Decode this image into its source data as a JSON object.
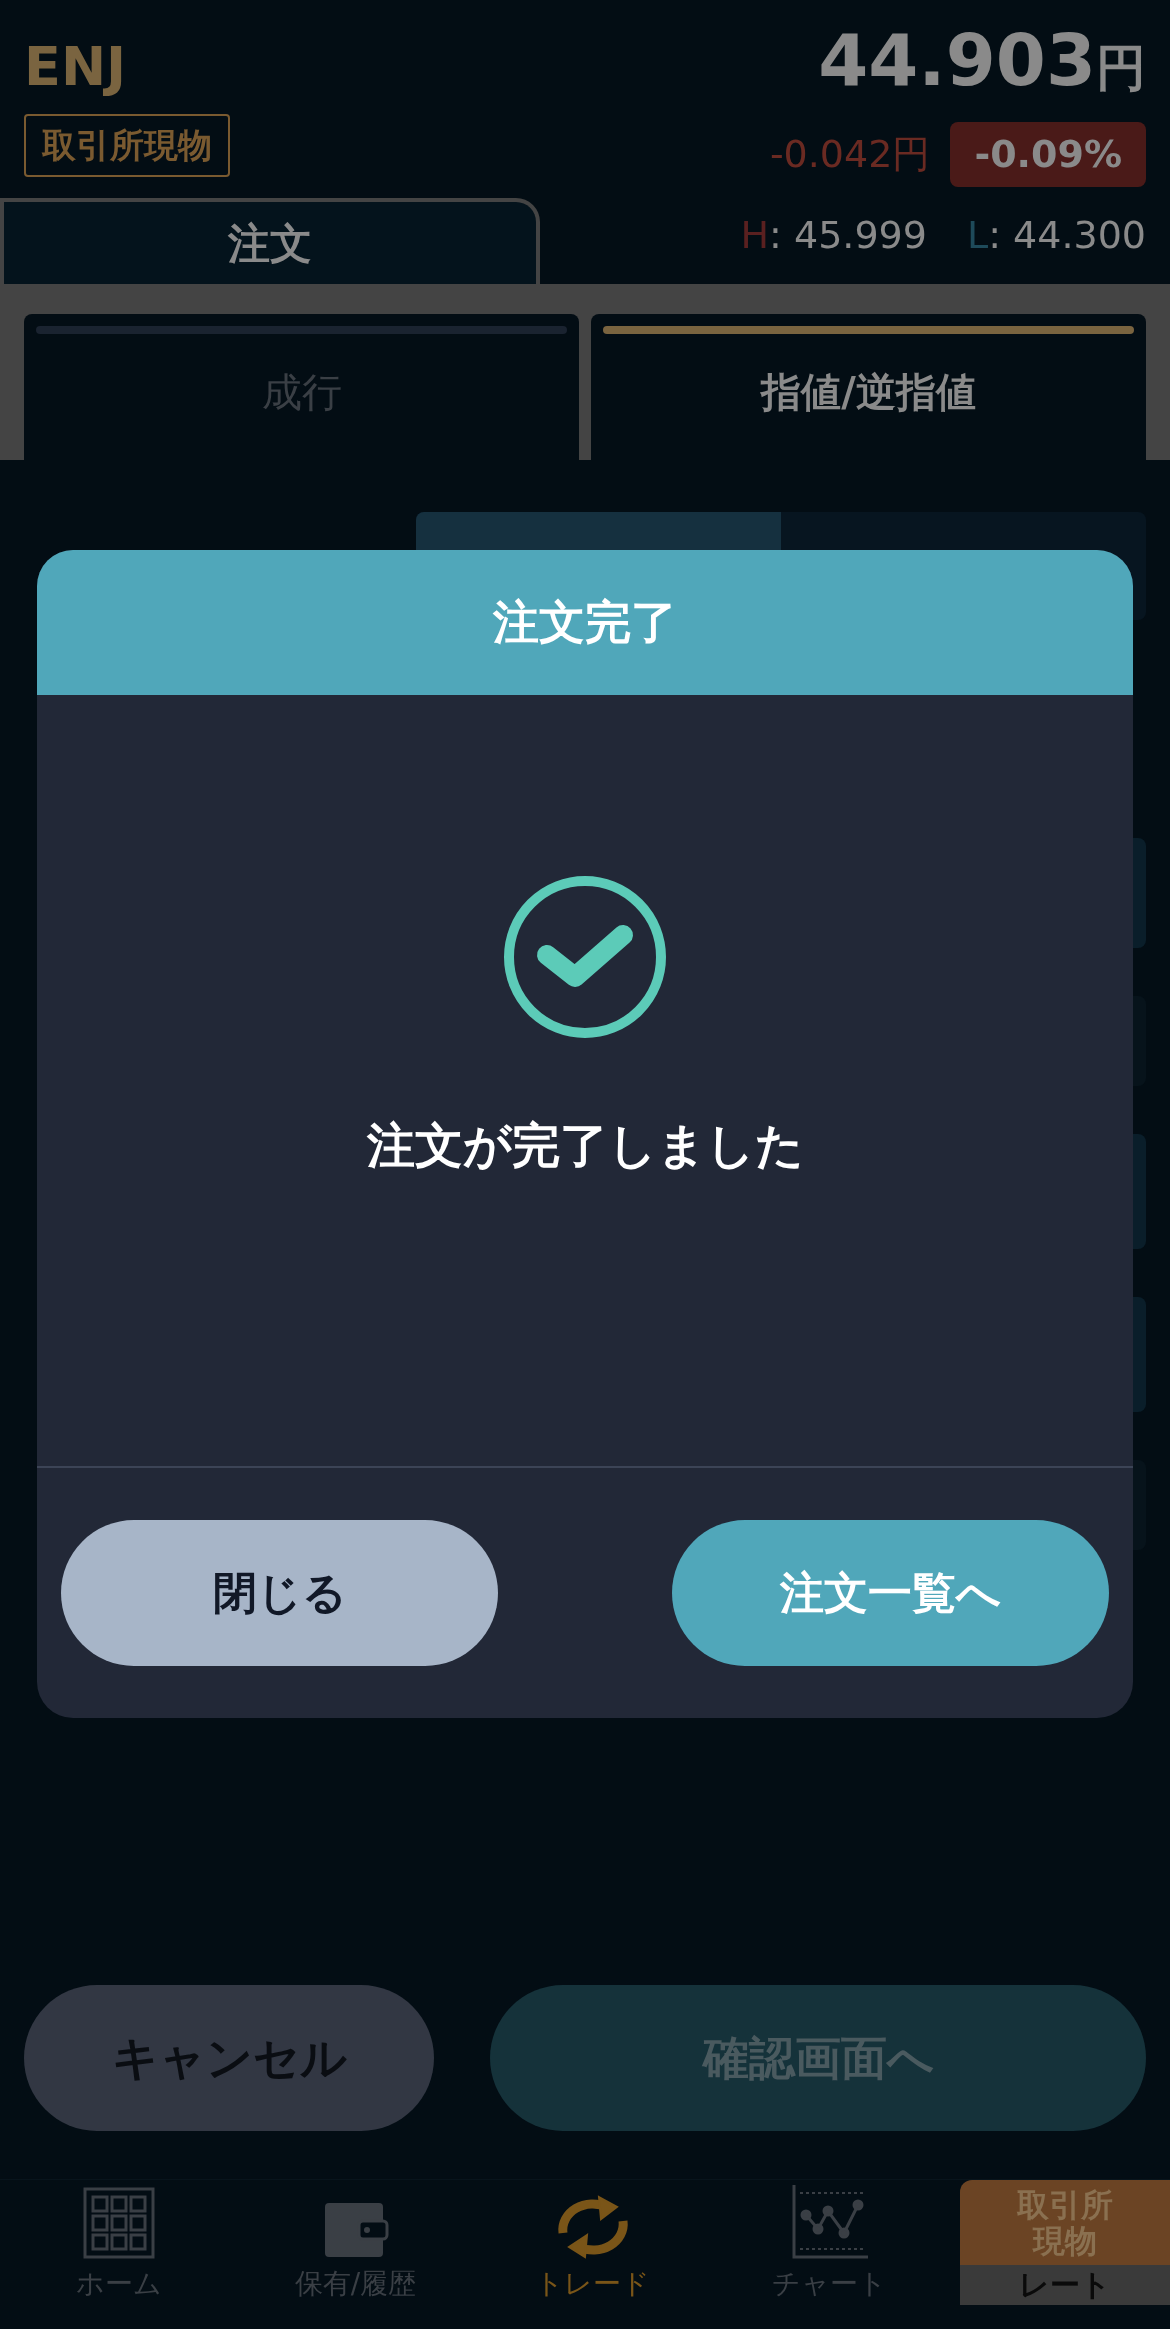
{
  "header": {
    "symbol": "ENJ",
    "price": "44.903",
    "price_unit": "円",
    "market_badge": "取引所現物",
    "change": "-0.042円",
    "change_percent": "-0.09%"
  },
  "tabs": [
    {
      "label": "注文",
      "selected": true
    }
  ],
  "high": {
    "label": "H",
    "value": ": 45.999"
  },
  "low": {
    "label": "L",
    "value": ": 44.300"
  },
  "order_types": [
    {
      "label": "成行",
      "selected": false
    },
    {
      "label": "指値/逆指値",
      "selected": true
    }
  ],
  "dialog": {
    "title": "注文完了",
    "message": "注文が完了しました",
    "buttons": [
      {
        "label": "閉じる",
        "kind": "secondary"
      },
      {
        "label": "注文一覧へ",
        "kind": "primary"
      }
    ]
  },
  "actions": [
    {
      "label": "キャンセル",
      "kind": "secondary"
    },
    {
      "label": "確認画面へ",
      "kind": "primary"
    }
  ],
  "nav": [
    {
      "label": "ホーム",
      "selected": false
    },
    {
      "label": "保有/履歴",
      "selected": false
    },
    {
      "label": "トレード",
      "selected": true
    },
    {
      "label": "チャート",
      "selected": false
    }
  ],
  "rate_tab": {
    "lines": [
      "取引所",
      "現物"
    ],
    "label": "レート"
  }
}
